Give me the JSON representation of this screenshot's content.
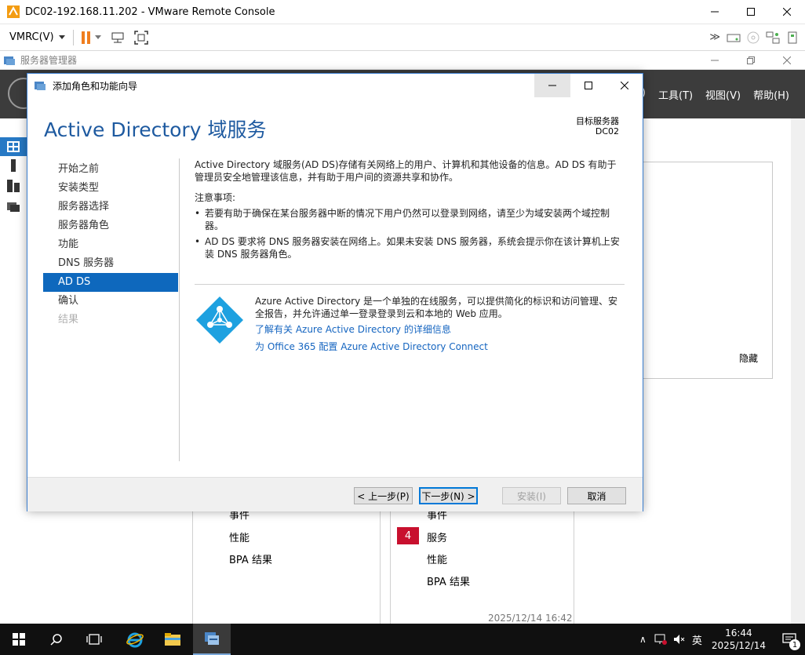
{
  "vmrc": {
    "title": "DC02-192.168.11.202 - VMware Remote Console",
    "menu_label": "VMRC(V)"
  },
  "server_manager": {
    "title": "服务器管理器",
    "menu": [
      "M)",
      "工具(T)",
      "视图(V)",
      "帮助(H)"
    ],
    "hide_label": "隐藏",
    "tile_left_rows": [
      "事件",
      "性能",
      "BPA 结果"
    ],
    "tile_right_rows": [
      "事件",
      "服务",
      "性能",
      "BPA 结果"
    ],
    "services_badge": "4",
    "timestamp": "2025/12/14 16:42"
  },
  "wizard": {
    "title": "添加角色和功能向导",
    "heading": "Active Directory 域服务",
    "target_label": "目标服务器",
    "target_value": "DC02",
    "nav": [
      {
        "label": "开始之前",
        "state": "normal"
      },
      {
        "label": "安装类型",
        "state": "normal"
      },
      {
        "label": "服务器选择",
        "state": "normal"
      },
      {
        "label": "服务器角色",
        "state": "normal"
      },
      {
        "label": "功能",
        "state": "normal"
      },
      {
        "label": "DNS 服务器",
        "state": "normal"
      },
      {
        "label": "AD DS",
        "state": "selected"
      },
      {
        "label": "确认",
        "state": "normal"
      },
      {
        "label": "结果",
        "state": "disabled"
      }
    ],
    "description": "Active Directory 域服务(AD DS)存储有关网络上的用户、计算机和其他设备的信息。AD DS 有助于管理员安全地管理该信息，并有助于用户间的资源共享和协作。",
    "notes_title": "注意事项:",
    "notes": [
      "若要有助于确保在某台服务器中断的情况下用户仍然可以登录到网络，请至少为域安装两个域控制器。",
      "AD DS 要求将 DNS 服务器安装在网络上。如果未安装 DNS 服务器，系统会提示你在该计算机上安装 DNS 服务器角色。"
    ],
    "azure_text": "Azure Active Directory 是一个单独的在线服务，可以提供简化的标识和访问管理、安全报告，并允许通过单一登录登录到云和本地的 Web 应用。",
    "azure_link1": "了解有关 Azure Active Directory 的详细信息",
    "azure_link2": "为 Office 365 配置 Azure Active Directory Connect",
    "buttons": {
      "prev": "< 上一步(P)",
      "next": "下一步(N) >",
      "install": "安装(I)",
      "cancel": "取消"
    }
  },
  "taskbar": {
    "ime": "英",
    "time": "16:44",
    "date": "2025/12/14",
    "notifications": "1"
  },
  "colors": {
    "accent": "#0e68bd",
    "heading": "#1e5aa0",
    "link": "#1565c0",
    "badge": "#c8102e"
  }
}
